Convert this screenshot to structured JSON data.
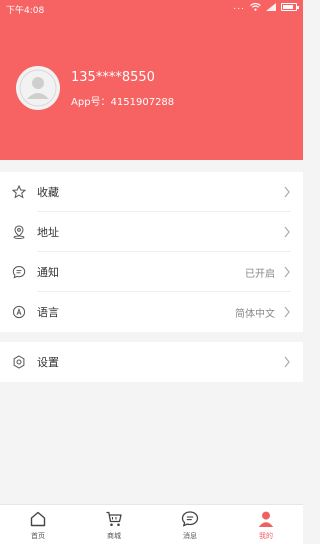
{
  "status_bar": {
    "time": "下午4:08",
    "dots": "..."
  },
  "profile": {
    "phone": "135****8550",
    "app_id": "App号：4151907288"
  },
  "menu_group1": [
    {
      "key": "favorites",
      "label": "收藏",
      "value": ""
    },
    {
      "key": "address",
      "label": "地址",
      "value": ""
    },
    {
      "key": "notifications",
      "label": "通知",
      "value": "已开启"
    },
    {
      "key": "language",
      "label": "语言",
      "value": "简体中文"
    }
  ],
  "menu_group2": [
    {
      "key": "settings",
      "label": "设置",
      "value": ""
    }
  ],
  "tabbar": {
    "items": [
      {
        "label": "首页",
        "icon": "home-icon",
        "active": false
      },
      {
        "label": "商城",
        "icon": "cart-icon",
        "active": false
      },
      {
        "label": "消息",
        "icon": "message-icon",
        "active": false
      },
      {
        "label": "我的",
        "icon": "user-icon",
        "active": true
      }
    ]
  },
  "colors": {
    "brand_red": "#f76262",
    "active_tab": "#f06262",
    "background": "#f4f4f4"
  }
}
